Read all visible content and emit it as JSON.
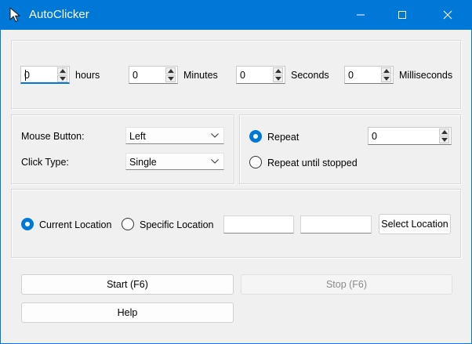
{
  "window": {
    "title": "AutoClicker"
  },
  "time": {
    "hours": {
      "value": "0",
      "label": "hours"
    },
    "minutes": {
      "value": "0",
      "label": "Minutes"
    },
    "seconds": {
      "value": "0",
      "label": "Seconds"
    },
    "milliseconds": {
      "value": "0",
      "label": "Milliseconds"
    }
  },
  "click_options": {
    "mouse_button": {
      "label": "Mouse Button:",
      "value": "Left"
    },
    "click_type": {
      "label": "Click Type:",
      "value": "Single"
    }
  },
  "repeat": {
    "repeat_label": "Repeat",
    "repeat_count": "0",
    "repeat_selected": true,
    "until_stopped_label": "Repeat until stopped"
  },
  "location": {
    "current_label": "Current Location",
    "current_selected": true,
    "specific_label": "Specific Location",
    "x_value": "",
    "y_value": "",
    "select_button": "Select Location"
  },
  "actions": {
    "start": "Start (F6)",
    "stop": "Stop (F6)",
    "help": "Help"
  },
  "colors": {
    "accent": "#0078d7",
    "window_bg": "#f0f0f0"
  },
  "icons": {
    "app": "cursor-arrow-icon",
    "minimize": "minimize-icon",
    "maximize": "maximize-icon",
    "close": "close-icon"
  }
}
